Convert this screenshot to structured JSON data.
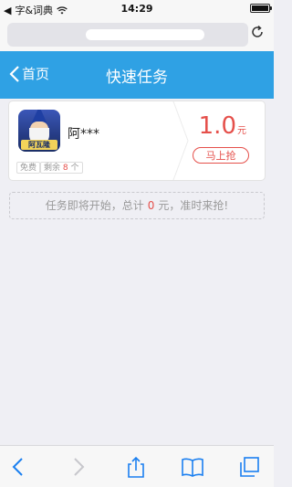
{
  "status_bar": {
    "carrier": "字&词典",
    "time": "14:29"
  },
  "browser": {
    "url_text": ""
  },
  "nav": {
    "back_label": "首页",
    "title": "快速任务"
  },
  "task": {
    "app_name": "阿***",
    "icon_plate_text": "阿瓦隆",
    "free_label": "免费",
    "remaining_prefix": "剩余",
    "remaining_count": "8",
    "remaining_suffix": "个",
    "price_value": "1.0",
    "price_unit": "元",
    "grab_label": "马上抢"
  },
  "notice": {
    "prefix": "任务即将开始，总计",
    "amount": "0",
    "suffix": "元，准时来抢!"
  },
  "colors": {
    "nav_blue": "#2fa1e4",
    "accent_red": "#e5504b"
  }
}
